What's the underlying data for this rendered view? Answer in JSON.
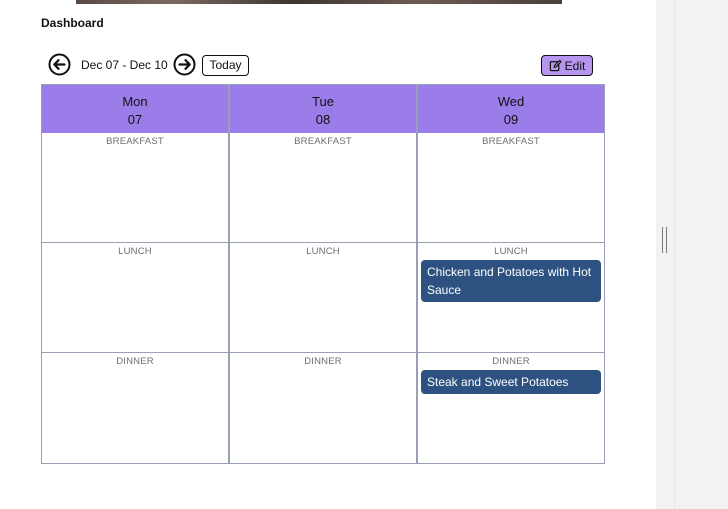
{
  "header": {
    "title": "Dashboard"
  },
  "toolbar": {
    "date_range": "Dec 07 - Dec 10",
    "today_label": "Today",
    "edit_label": "Edit"
  },
  "calendar": {
    "days": [
      {
        "name": "Mon",
        "date": "07"
      },
      {
        "name": "Tue",
        "date": "08"
      },
      {
        "name": "Wed",
        "date": "09"
      }
    ],
    "slot_labels": [
      "BREAKFAST",
      "LUNCH",
      "DINNER"
    ],
    "meals": {
      "wed_lunch": "Chicken and Potatoes with Hot Sauce",
      "wed_dinner": "Steak and Sweet Potatoes"
    }
  },
  "colors": {
    "header_bg": "#9b7de9",
    "edit_button_bg": "#b595ee",
    "meal_card_bg": "#2d5281"
  }
}
